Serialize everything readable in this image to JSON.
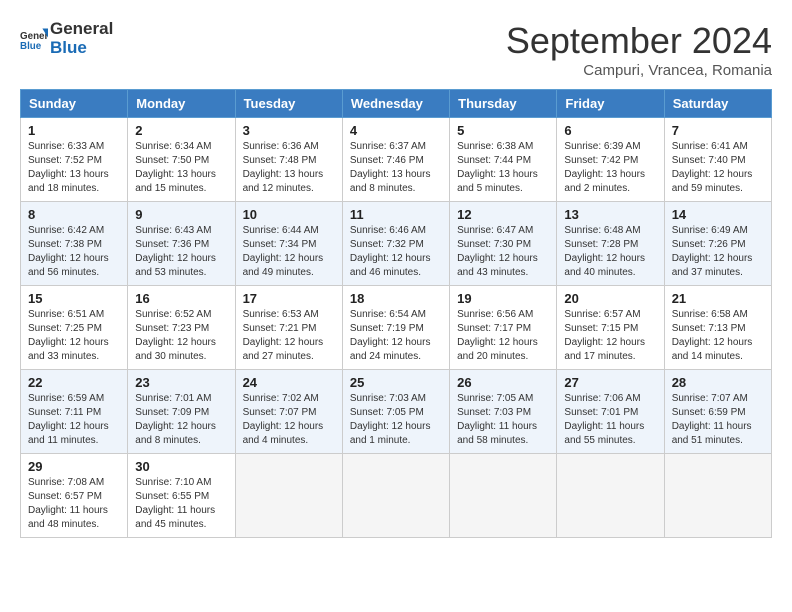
{
  "logo": {
    "line1": "General",
    "line2": "Blue"
  },
  "title": "September 2024",
  "subtitle": "Campuri, Vrancea, Romania",
  "days_header": [
    "Sunday",
    "Monday",
    "Tuesday",
    "Wednesday",
    "Thursday",
    "Friday",
    "Saturday"
  ],
  "weeks": [
    [
      {
        "num": "1",
        "info": "Sunrise: 6:33 AM\nSunset: 7:52 PM\nDaylight: 13 hours\nand 18 minutes."
      },
      {
        "num": "2",
        "info": "Sunrise: 6:34 AM\nSunset: 7:50 PM\nDaylight: 13 hours\nand 15 minutes."
      },
      {
        "num": "3",
        "info": "Sunrise: 6:36 AM\nSunset: 7:48 PM\nDaylight: 13 hours\nand 12 minutes."
      },
      {
        "num": "4",
        "info": "Sunrise: 6:37 AM\nSunset: 7:46 PM\nDaylight: 13 hours\nand 8 minutes."
      },
      {
        "num": "5",
        "info": "Sunrise: 6:38 AM\nSunset: 7:44 PM\nDaylight: 13 hours\nand 5 minutes."
      },
      {
        "num": "6",
        "info": "Sunrise: 6:39 AM\nSunset: 7:42 PM\nDaylight: 13 hours\nand 2 minutes."
      },
      {
        "num": "7",
        "info": "Sunrise: 6:41 AM\nSunset: 7:40 PM\nDaylight: 12 hours\nand 59 minutes."
      }
    ],
    [
      {
        "num": "8",
        "info": "Sunrise: 6:42 AM\nSunset: 7:38 PM\nDaylight: 12 hours\nand 56 minutes."
      },
      {
        "num": "9",
        "info": "Sunrise: 6:43 AM\nSunset: 7:36 PM\nDaylight: 12 hours\nand 53 minutes."
      },
      {
        "num": "10",
        "info": "Sunrise: 6:44 AM\nSunset: 7:34 PM\nDaylight: 12 hours\nand 49 minutes."
      },
      {
        "num": "11",
        "info": "Sunrise: 6:46 AM\nSunset: 7:32 PM\nDaylight: 12 hours\nand 46 minutes."
      },
      {
        "num": "12",
        "info": "Sunrise: 6:47 AM\nSunset: 7:30 PM\nDaylight: 12 hours\nand 43 minutes."
      },
      {
        "num": "13",
        "info": "Sunrise: 6:48 AM\nSunset: 7:28 PM\nDaylight: 12 hours\nand 40 minutes."
      },
      {
        "num": "14",
        "info": "Sunrise: 6:49 AM\nSunset: 7:26 PM\nDaylight: 12 hours\nand 37 minutes."
      }
    ],
    [
      {
        "num": "15",
        "info": "Sunrise: 6:51 AM\nSunset: 7:25 PM\nDaylight: 12 hours\nand 33 minutes."
      },
      {
        "num": "16",
        "info": "Sunrise: 6:52 AM\nSunset: 7:23 PM\nDaylight: 12 hours\nand 30 minutes."
      },
      {
        "num": "17",
        "info": "Sunrise: 6:53 AM\nSunset: 7:21 PM\nDaylight: 12 hours\nand 27 minutes."
      },
      {
        "num": "18",
        "info": "Sunrise: 6:54 AM\nSunset: 7:19 PM\nDaylight: 12 hours\nand 24 minutes."
      },
      {
        "num": "19",
        "info": "Sunrise: 6:56 AM\nSunset: 7:17 PM\nDaylight: 12 hours\nand 20 minutes."
      },
      {
        "num": "20",
        "info": "Sunrise: 6:57 AM\nSunset: 7:15 PM\nDaylight: 12 hours\nand 17 minutes."
      },
      {
        "num": "21",
        "info": "Sunrise: 6:58 AM\nSunset: 7:13 PM\nDaylight: 12 hours\nand 14 minutes."
      }
    ],
    [
      {
        "num": "22",
        "info": "Sunrise: 6:59 AM\nSunset: 7:11 PM\nDaylight: 12 hours\nand 11 minutes."
      },
      {
        "num": "23",
        "info": "Sunrise: 7:01 AM\nSunset: 7:09 PM\nDaylight: 12 hours\nand 8 minutes."
      },
      {
        "num": "24",
        "info": "Sunrise: 7:02 AM\nSunset: 7:07 PM\nDaylight: 12 hours\nand 4 minutes."
      },
      {
        "num": "25",
        "info": "Sunrise: 7:03 AM\nSunset: 7:05 PM\nDaylight: 12 hours\nand 1 minute."
      },
      {
        "num": "26",
        "info": "Sunrise: 7:05 AM\nSunset: 7:03 PM\nDaylight: 11 hours\nand 58 minutes."
      },
      {
        "num": "27",
        "info": "Sunrise: 7:06 AM\nSunset: 7:01 PM\nDaylight: 11 hours\nand 55 minutes."
      },
      {
        "num": "28",
        "info": "Sunrise: 7:07 AM\nSunset: 6:59 PM\nDaylight: 11 hours\nand 51 minutes."
      }
    ],
    [
      {
        "num": "29",
        "info": "Sunrise: 7:08 AM\nSunset: 6:57 PM\nDaylight: 11 hours\nand 48 minutes."
      },
      {
        "num": "30",
        "info": "Sunrise: 7:10 AM\nSunset: 6:55 PM\nDaylight: 11 hours\nand 45 minutes."
      },
      {
        "num": "",
        "info": ""
      },
      {
        "num": "",
        "info": ""
      },
      {
        "num": "",
        "info": ""
      },
      {
        "num": "",
        "info": ""
      },
      {
        "num": "",
        "info": ""
      }
    ]
  ]
}
